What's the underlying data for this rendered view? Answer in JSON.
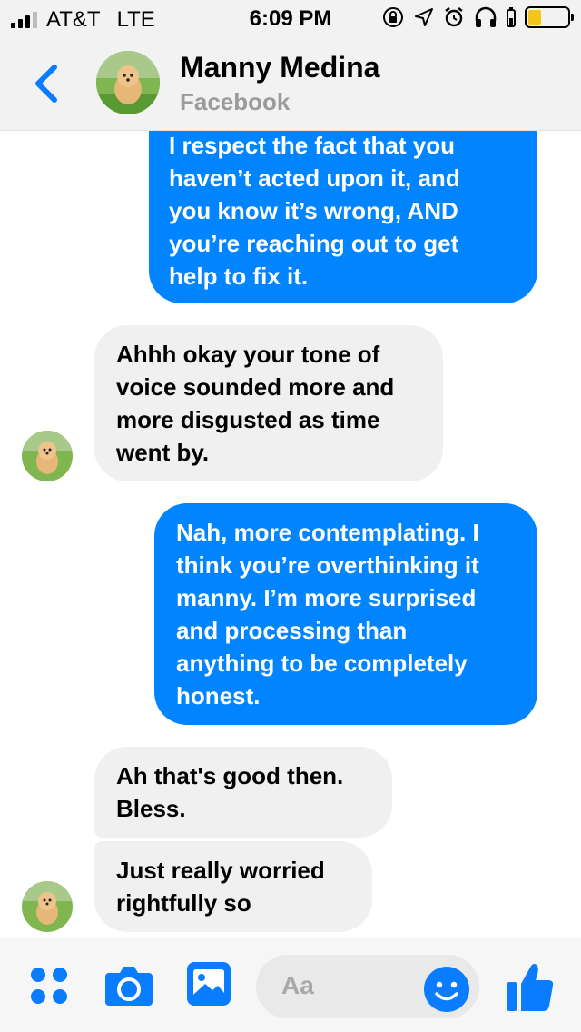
{
  "status_bar": {
    "carrier": "AT&T",
    "network": "LTE",
    "time": "6:09 PM",
    "battery_level": 0.33
  },
  "header": {
    "contact_name": "Manny Medina",
    "contact_source": "Facebook",
    "back_icon": "chevron-left-icon"
  },
  "messages": [
    {
      "direction": "outgoing",
      "lines": [
        "I respect the fact that you",
        "haven’t acted upon it, and",
        "you know it’s wrong, AND",
        "you’re reaching out to get",
        "help to fix it."
      ]
    },
    {
      "direction": "incoming",
      "lines": [
        "Ahhh okay your tone of",
        "voice sounded more and",
        "more disgusted as time",
        "went by."
      ]
    },
    {
      "direction": "outgoing",
      "lines": [
        "Nah, more contemplating. I",
        "think you’re overthinking it",
        "manny. I’m more surprised",
        "and processing than",
        "anything to be completely",
        "honest."
      ]
    },
    {
      "direction": "incoming",
      "lines": [
        "Ah that's good then.",
        "Bless."
      ]
    },
    {
      "direction": "incoming",
      "lines": [
        "Just really worried",
        "rightfully so"
      ]
    }
  ],
  "composer": {
    "placeholder": "Aa",
    "icons": [
      "apps-icon",
      "camera-icon",
      "gallery-icon",
      "emoji-icon",
      "thumbs-up-icon"
    ]
  },
  "colors": {
    "outgoing_bubble": "#0084ff",
    "incoming_bubble": "#f1f0f0",
    "accent": "#0a7cff"
  }
}
